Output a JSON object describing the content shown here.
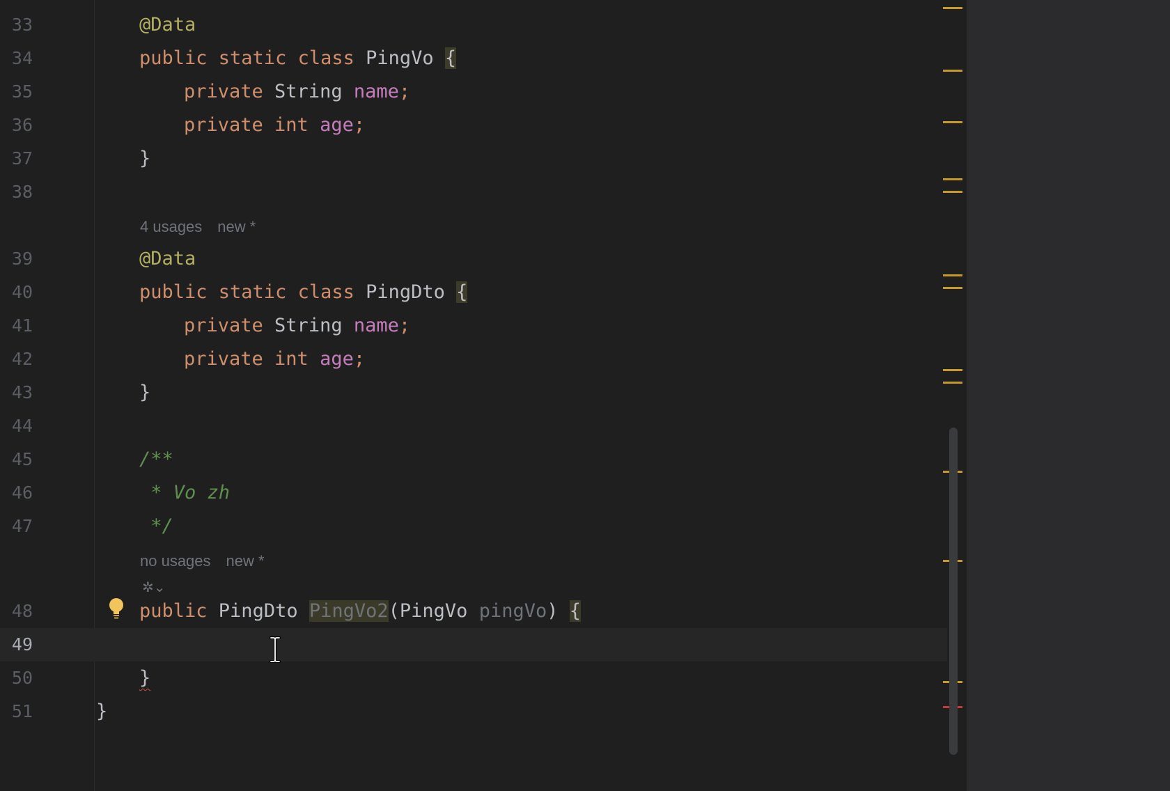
{
  "editor": {
    "lines": [
      {
        "num": "33",
        "parts": [
          {
            "t": "@Data",
            "c": "ann"
          }
        ]
      },
      {
        "num": "34",
        "parts": [
          {
            "t": "public static class ",
            "c": "kw"
          },
          {
            "t": "PingVo ",
            "c": ""
          },
          {
            "t": "{",
            "c": "brace-hl"
          }
        ]
      },
      {
        "num": "35",
        "parts": [
          {
            "t": "private ",
            "c": "kw"
          },
          {
            "t": "String ",
            "c": ""
          },
          {
            "t": "name",
            "c": "fld"
          },
          {
            "t": ";",
            "c": "kw"
          }
        ]
      },
      {
        "num": "36",
        "parts": [
          {
            "t": "private int ",
            "c": "kw"
          },
          {
            "t": "age",
            "c": "fld"
          },
          {
            "t": ";",
            "c": "kw"
          }
        ]
      },
      {
        "num": "37",
        "parts": [
          {
            "t": "}",
            "c": ""
          }
        ]
      },
      {
        "num": "38",
        "parts": []
      },
      {
        "num": "39",
        "parts": [
          {
            "t": "@Data",
            "c": "ann"
          }
        ]
      },
      {
        "num": "40",
        "parts": [
          {
            "t": "public static class ",
            "c": "kw"
          },
          {
            "t": "PingDto ",
            "c": ""
          },
          {
            "t": "{",
            "c": "brace-hl"
          }
        ]
      },
      {
        "num": "41",
        "parts": [
          {
            "t": "private ",
            "c": "kw"
          },
          {
            "t": "String ",
            "c": ""
          },
          {
            "t": "name",
            "c": "fld"
          },
          {
            "t": ";",
            "c": "kw"
          }
        ]
      },
      {
        "num": "42",
        "parts": [
          {
            "t": "private int ",
            "c": "kw"
          },
          {
            "t": "age",
            "c": "fld"
          },
          {
            "t": ";",
            "c": "kw"
          }
        ]
      },
      {
        "num": "43",
        "parts": [
          {
            "t": "}",
            "c": ""
          }
        ]
      },
      {
        "num": "44",
        "parts": []
      },
      {
        "num": "45",
        "parts": [
          {
            "t": "/**",
            "c": "cmt"
          }
        ]
      },
      {
        "num": "46",
        "parts": [
          {
            "t": " * Vo zh",
            "c": "cmt"
          }
        ]
      },
      {
        "num": "47",
        "parts": [
          {
            "t": " */",
            "c": "cmt"
          }
        ]
      },
      {
        "num": "48",
        "parts": [
          {
            "t": "public ",
            "c": "kw"
          },
          {
            "t": "PingDto ",
            "c": ""
          },
          {
            "t": "PingVo2",
            "c": "unused"
          },
          {
            "t": "(PingVo ",
            "c": ""
          },
          {
            "t": "pingVo",
            "c": "pname"
          },
          {
            "t": ") ",
            "c": ""
          },
          {
            "t": "{",
            "c": "brace-hl"
          }
        ]
      },
      {
        "num": "49",
        "parts": []
      },
      {
        "num": "50",
        "parts": [
          {
            "t": "}",
            "c": "squiggle"
          }
        ]
      },
      {
        "num": "51",
        "parts": [
          {
            "t": "}",
            "c": ""
          }
        ]
      }
    ],
    "hints": {
      "pingdto_usages": "4 usages",
      "pingdto_author": "new *",
      "method_usages": "no usages",
      "method_author": "new *"
    },
    "ai_icon_glyph": "✲⌄",
    "current_line": "49"
  },
  "colors": {
    "background": "#1f1f1f",
    "keyword": "#cf8e6d",
    "annotation": "#b3ae60",
    "field": "#c77dbb",
    "comment": "#5f8f4f",
    "warning_marker": "#c59a2a",
    "error_marker": "#c43b3b"
  }
}
